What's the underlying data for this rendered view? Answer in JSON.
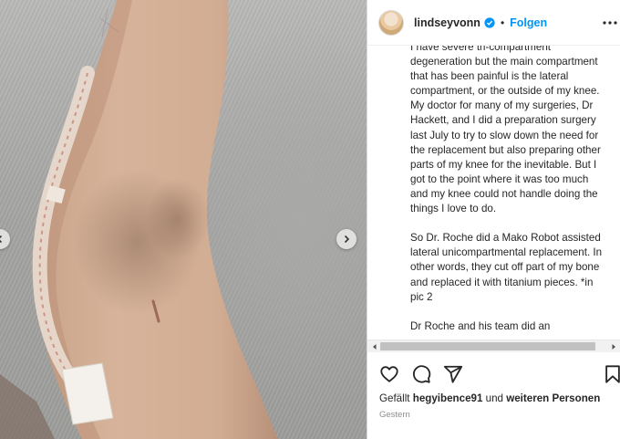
{
  "header": {
    "username": "lindseyvonn",
    "separator": "•",
    "follow_label": "Folgen",
    "avatar_icon": "profile-avatar",
    "verified_icon": "verified-badge-icon",
    "more_icon": "more-options-icon"
  },
  "caption": {
    "paragraphs": [
      "I have severe tri-compartment degeneration but the main compartment that has been painful is the lateral compartment, or the outside of my knee. My doctor for many of my surgeries, Dr Hackett, and I did a preparation surgery last July to try to slow down the need for the replacement but also preparing other parts of my knee for the inevitable. But I got to the point where it was too much and my knee could not handle doing the things I love to do.",
      "So Dr. Roche did a Mako Robot assisted lateral unicompartmental replacement. In other words, they cut off part of my bone and replaced it with titanium pieces. *in pic 2",
      "Dr Roche and his team did an"
    ]
  },
  "media": {
    "description_icon": "photo-knee",
    "prev_icon": "chevron-left-icon",
    "next_icon": "chevron-right-icon"
  },
  "actions": {
    "like_icon": "heart-icon",
    "comment_icon": "comment-icon",
    "share_icon": "share-icon",
    "save_icon": "bookmark-icon"
  },
  "likes": {
    "prefix": "Gefällt ",
    "user": "hegyibence91",
    "middle": " und ",
    "rest": "weiteren Personen"
  },
  "timestamp": "Gestern",
  "colors": {
    "accent": "#0095f6",
    "text": "#262626",
    "muted": "#8e8e8e"
  }
}
